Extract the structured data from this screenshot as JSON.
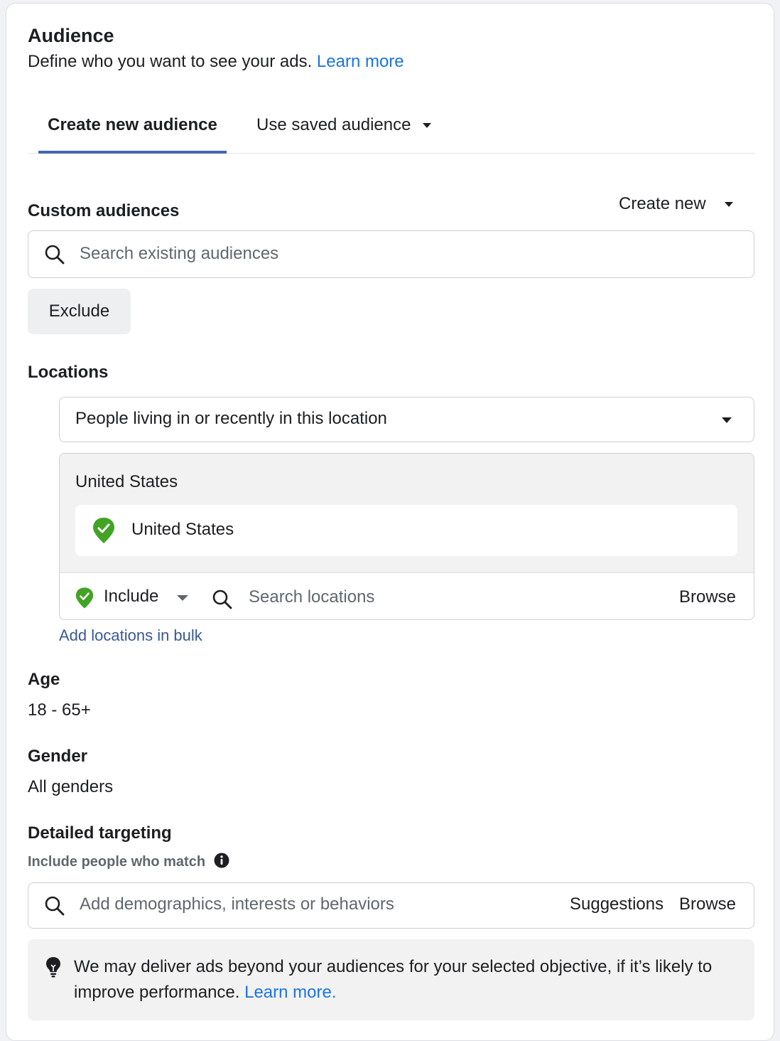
{
  "header": {
    "title": "Audience",
    "subtitle": "Define who you want to see your ads.",
    "learn_more": "Learn more"
  },
  "tabs": {
    "create": "Create new audience",
    "saved": "Use saved audience"
  },
  "custom_audiences": {
    "label": "Custom audiences",
    "create_new": "Create new",
    "search_placeholder": "Search existing audiences",
    "exclude": "Exclude"
  },
  "locations": {
    "label": "Locations",
    "dropdown_value": "People living in or recently in this location",
    "group_header": "United States",
    "selected": "United States",
    "include": "Include",
    "search_placeholder": "Search locations",
    "browse": "Browse",
    "add_bulk": "Add locations in bulk"
  },
  "age": {
    "label": "Age",
    "value": "18 - 65+"
  },
  "gender": {
    "label": "Gender",
    "value": "All genders"
  },
  "detailed": {
    "label": "Detailed targeting",
    "sub": "Include people who match",
    "search_placeholder": "Add demographics, interests or behaviors",
    "suggestions": "Suggestions",
    "browse": "Browse"
  },
  "notice": {
    "text": "We may deliver ads beyond your audiences for your selected objective, if it’s likely to improve performance.",
    "learn_more": "Learn more."
  },
  "colors": {
    "link": "#1b74e4",
    "tab_indicator": "#4267b2",
    "pin_green": "#42a325"
  }
}
